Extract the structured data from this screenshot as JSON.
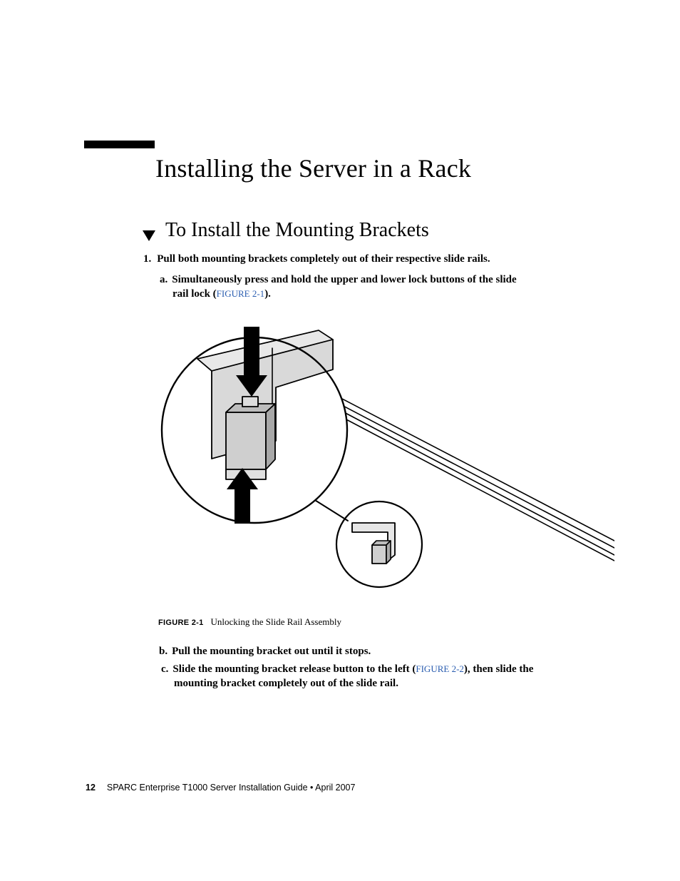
{
  "heading": "Installing the Server in a Rack",
  "subheading": "To Install the Mounting Brackets",
  "step1_num": "1.",
  "step1_text": "Pull both mounting brackets completely out of their respective slide rails.",
  "sub_a_letter": "a.",
  "sub_a_text_1": "Simultaneously press and hold the upper and lower lock buttons of the slide",
  "sub_a_text_2": "rail lock (",
  "sub_a_link": "FIGURE 2-1",
  "sub_a_text_3": ").",
  "figure_label": "FIGURE 2-1",
  "figure_caption": "Unlocking the Slide Rail Assembly",
  "sub_b_letter": "b.",
  "sub_b_text": "Pull the mounting bracket out until it stops.",
  "sub_c_letter": "c.",
  "sub_c_text_1": "Slide the mounting bracket release button to the left (",
  "sub_c_link": "FIGURE 2-2",
  "sub_c_text_2": "), then slide the",
  "sub_c_text_3": "mounting bracket completely out of the slide rail.",
  "footer_page": "12",
  "footer_text": "SPARC Enterprise T1000 Server Installation Guide • April 2007"
}
